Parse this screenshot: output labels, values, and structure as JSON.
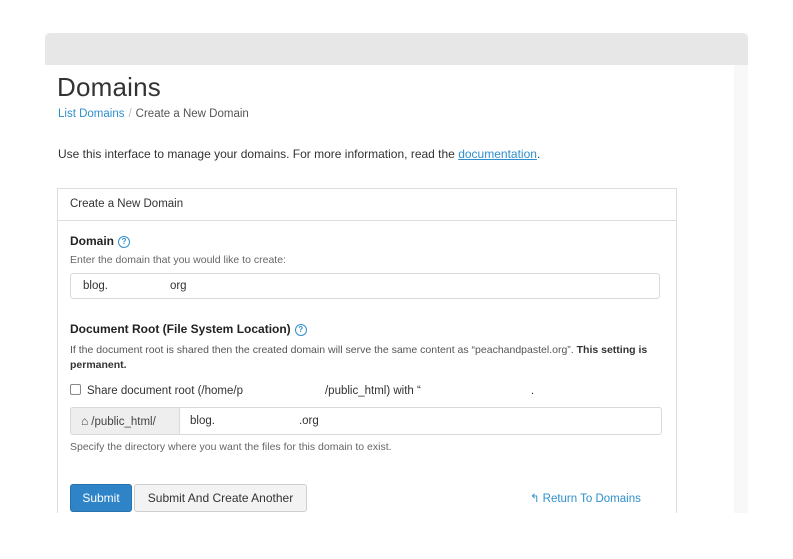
{
  "page": {
    "title": "Domains",
    "breadcrumb": {
      "link": "List Domains",
      "separator": "/",
      "current": "Create a New Domain"
    },
    "intro_text": "Use this interface to manage your domains. For more information, read the ",
    "intro_link": "documentation",
    "intro_end": "."
  },
  "panel": {
    "heading": "Create a New Domain",
    "domain": {
      "label": "Domain",
      "help": "?",
      "hint": "Enter the domain that you would like to create:",
      "value_prefix": "blog.",
      "value_suffix": "org"
    },
    "docroot": {
      "label": "Document Root (File System Location)",
      "help": "?",
      "description": "If the document root is shared then the created domain will serve the same content as “peachandpastel.org”. ",
      "description_bold": "This setting is permanent.",
      "share_prefix": "Share document root (/home/p",
      "share_middle": "/public_html) with “",
      "share_end": ".",
      "addon_icon": "⌂",
      "addon_label": "/public_html/",
      "value_prefix": "blog.",
      "value_suffix": ".org",
      "hint": "Specify the directory where you want the files for this domain to exist."
    },
    "buttons": {
      "submit": "Submit",
      "submit_another": "Submit And Create Another",
      "return_icon": "↰",
      "return": "Return To Domains"
    }
  },
  "colors": {
    "accent": "#2f84c8",
    "link": "#2f8fcd"
  }
}
